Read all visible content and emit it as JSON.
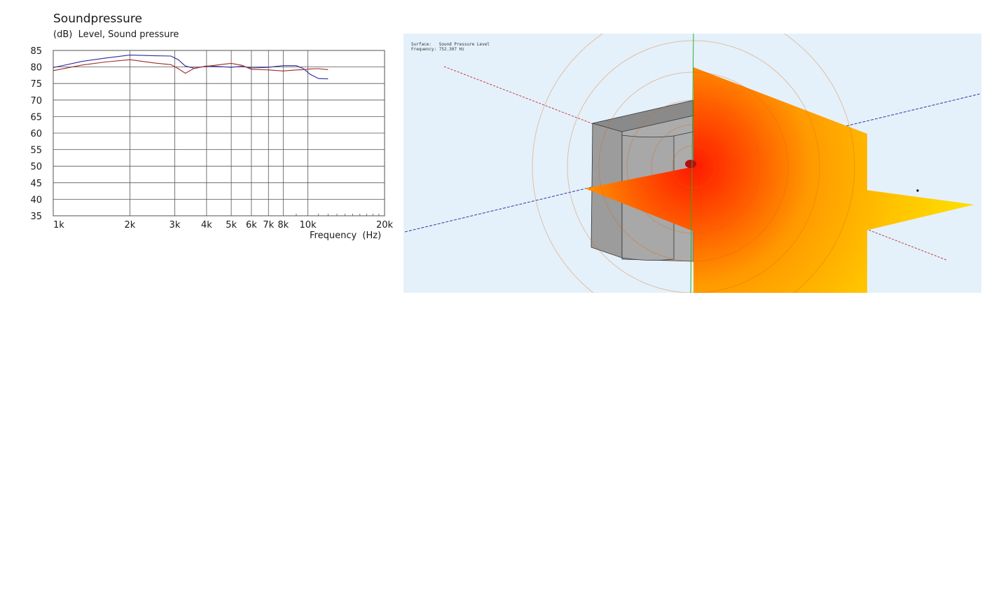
{
  "chart": {
    "title": "Soundpressure",
    "subtitle": "(dB)  Level, Sound pressure",
    "xlabel": "Frequency  (Hz)"
  },
  "chart_data": {
    "type": "line",
    "title": "Soundpressure",
    "ylabel": "(dB)  Level, Sound pressure",
    "xlabel": "Frequency  (Hz)",
    "xscale": "log",
    "xlim": [
      1000,
      20000
    ],
    "ylim": [
      35,
      85
    ],
    "yticks": [
      85,
      80,
      75,
      70,
      65,
      60,
      55,
      50,
      45,
      40,
      35
    ],
    "xtick_values": [
      1000,
      2000,
      3000,
      4000,
      5000,
      6000,
      7000,
      8000,
      10000,
      20000
    ],
    "xtick_labels": [
      "1k",
      "2k",
      "3k",
      "4k",
      "5k",
      "6k",
      "7k",
      "8k",
      "10k",
      "20k"
    ],
    "grid": true,
    "legend": "none",
    "series": [
      {
        "color": "#2a2aa0",
        "x": [
          1000,
          1300,
          1600,
          2000,
          2500,
          2900,
          3100,
          3300,
          3600,
          4000,
          4500,
          5000,
          5500,
          6000,
          7000,
          8000,
          9000,
          9600,
          10200,
          11000,
          12000
        ],
        "y": [
          79.8,
          81.7,
          82.7,
          83.6,
          83.4,
          83.3,
          82.2,
          80.3,
          79.6,
          80.3,
          80.1,
          79.9,
          80.2,
          79.7,
          79.9,
          80.4,
          80.4,
          79.5,
          77.8,
          76.5,
          76.4
        ]
      },
      {
        "color": "#a02a2a",
        "x": [
          1000,
          1300,
          1600,
          2000,
          2500,
          2900,
          3100,
          3300,
          3600,
          4000,
          4500,
          5000,
          5500,
          6000,
          7000,
          8000,
          9000,
          9600,
          10200,
          11000,
          12000
        ],
        "y": [
          78.9,
          80.6,
          81.5,
          82.2,
          81.2,
          80.7,
          79.5,
          78.1,
          79.7,
          80.2,
          80.7,
          81.1,
          80.5,
          79.3,
          79.1,
          78.8,
          79.1,
          79.2,
          79.4,
          79.5,
          79.2
        ]
      }
    ]
  },
  "simulation": {
    "info_line1": "Surface:   Sound Pressure Level",
    "info_line2": "Frequency: 752.307 Hz",
    "colors": {
      "background": "#e4f1fb",
      "field_hot": "#ff1a00",
      "field_mid": "#ff9a00",
      "field_cold": "#ffe400",
      "enclosure": "#a0a0a0",
      "axis_x": "#2a3a9a",
      "axis_y": "#2ab02a",
      "axis_z": "#c83a3a"
    }
  }
}
